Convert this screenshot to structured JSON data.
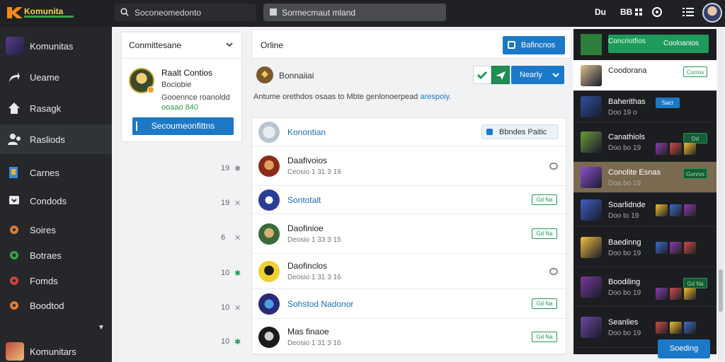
{
  "topbar": {
    "brand": "Komunita",
    "search_left": "Soconeomedonto",
    "search_center": "Sormecmaut mland",
    "btn1": "Du",
    "btn2": "BB"
  },
  "sidebar": {
    "items": [
      {
        "label": "Komunitas",
        "icon": "community-thumb"
      },
      {
        "label": "Ueame",
        "icon": "arrow-icon"
      },
      {
        "label": "Rasagk",
        "icon": "home-icon"
      },
      {
        "label": "Rasliods",
        "icon": "people-icon"
      },
      {
        "label": "Carnes",
        "icon": "games-icon"
      },
      {
        "label": "Condods",
        "icon": "chat-icon"
      },
      {
        "label": "Soires",
        "icon": "orange-dot-icon"
      },
      {
        "label": "Botraes",
        "icon": "green-dot-icon"
      },
      {
        "label": "Fomds",
        "icon": "red-dot-icon"
      },
      {
        "label": "Boodtod",
        "icon": "orange-dot-icon"
      }
    ],
    "footer_label": "Komunitars"
  },
  "panel1": {
    "header": "Conmittesane",
    "name": "Raalt Contios",
    "line1": "Bociobie",
    "line2": "Gooennce roanoldd",
    "line3": "ooaao 840",
    "button": "Secoumeonfittns"
  },
  "left_numbers": [
    {
      "num": "19",
      "star": "✱",
      "color": "#8a8d92"
    },
    {
      "num": "19",
      "star": "✕",
      "color": "#8a8d92"
    },
    {
      "num": "6",
      "star": "✕",
      "color": "#8a8d92"
    },
    {
      "num": "10",
      "star": "✱",
      "color": "#1e9a5b"
    },
    {
      "num": "10",
      "star": "✕",
      "color": "#8a8d92"
    },
    {
      "num": "10",
      "star": "✱",
      "color": "#1e9a5b"
    }
  ],
  "main": {
    "title": "Orline",
    "top_button": "Bafincnos",
    "group_name": "Bonnaiiai",
    "dropdown": "Nearly",
    "description": "Antume orethdos osaas to Mbte genlonoerpead",
    "description_link": "arespoiy."
  },
  "rows": [
    {
      "name": "Konontian",
      "sub": "",
      "blue": true,
      "right": "Bbndes Paitic"
    },
    {
      "name": "Daafivoios",
      "sub": "Ceosio 1 31 3 19",
      "blue": false,
      "right": "pill"
    },
    {
      "name": "Sontotalt",
      "sub": "",
      "blue": true,
      "right": "Gd Na"
    },
    {
      "name": "Daofinioe",
      "sub": "Deosio 1 33 3 15",
      "blue": false,
      "right": "Gd Na"
    },
    {
      "name": "Daofinclos",
      "sub": "Deosio 1 31 3 16",
      "blue": false,
      "right": "pill"
    },
    {
      "name": "Sohstod Nadonor",
      "sub": "",
      "blue": true,
      "right": "Gd Na"
    },
    {
      "name": "Mas finaoe",
      "sub": "Deosio 1 31 3 16",
      "blue": false,
      "right": "Gd Na"
    }
  ],
  "right_panel": {
    "header_left": "Concriotfios",
    "header_button": "Cooloanios",
    "rows": [
      {
        "name": "Coodorana",
        "sub": "",
        "style": "white",
        "action": "Cocios"
      },
      {
        "name": "Baherithas",
        "sub": "Doo 19 o",
        "style": "dark",
        "action": "Sacr"
      },
      {
        "name": "Canathiols",
        "sub": "Doo bo 19",
        "style": "dark",
        "action": "Dd"
      },
      {
        "name": "Conolite Esnas",
        "sub": "Doa bo 19",
        "style": "gold",
        "action": "Gonrvs"
      },
      {
        "name": "Soarlidnde",
        "sub": "Doo to 19",
        "style": "dark",
        "action": ""
      },
      {
        "name": "Baedinng",
        "sub": "Doo bo 19",
        "style": "dark",
        "action": ""
      },
      {
        "name": "Boodiling",
        "sub": "Doo bo 19",
        "style": "dark",
        "action": "Gd Na"
      },
      {
        "name": "Seanlies",
        "sub": "Doo bo 19",
        "style": "dark",
        "action": ""
      }
    ],
    "settings_button": "Soeding"
  },
  "colors": {
    "accent": "#1c79c7",
    "green": "#1e9a5b",
    "sidebar": "#25272b",
    "topbar": "#1f2125"
  }
}
